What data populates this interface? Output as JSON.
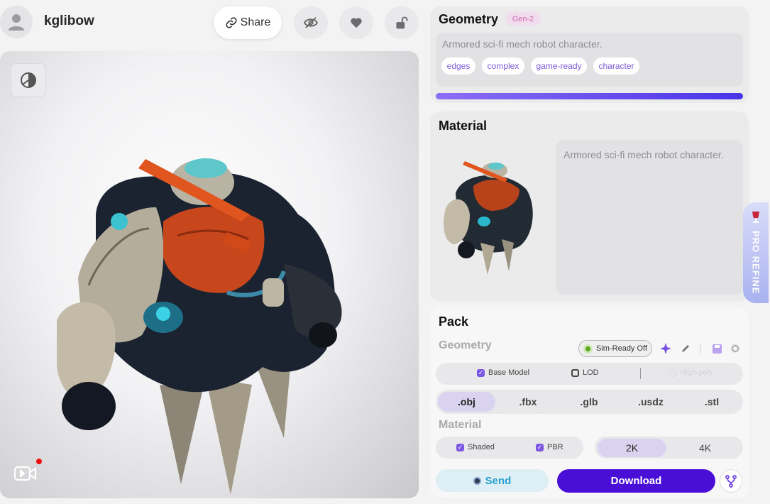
{
  "header": {
    "username": "kglibow",
    "share_label": "Share"
  },
  "geometry": {
    "title": "Geometry",
    "badge": "Gen-2",
    "description": "Armored sci-fi mech robot character.",
    "tags": [
      "edges",
      "complex",
      "game-ready",
      "character"
    ]
  },
  "material": {
    "title": "Material",
    "description": "Armored sci-fi mech robot character."
  },
  "pack": {
    "title": "Pack",
    "geometry_label": "Geometry",
    "sim_ready": "Sim-Ready Off",
    "options": {
      "base_model": "Base Model",
      "lod": "LOD",
      "high_poly": "High-poly"
    },
    "formats": [
      ".obj",
      ".fbx",
      ".glb",
      ".usdz",
      ".stl"
    ],
    "active_format": ".obj",
    "material_label": "Material",
    "material_options": {
      "shaded": "Shaded",
      "pbr": "PBR"
    },
    "resolutions": [
      "2K",
      "4K"
    ],
    "active_resolution": "2K",
    "send_label": "Send",
    "download_label": "Download"
  },
  "side_tab": {
    "label": "PRO REFINE"
  },
  "colors": {
    "accent": "#4a0fd6",
    "progress_start": "#8b6ff5",
    "progress_end": "#4a34e8",
    "tag_text": "#7c5bd6",
    "badge_bg": "#f1dcee",
    "send_text": "#2aa0cd"
  },
  "icons": {
    "avatar": "user-icon",
    "share": "link-icon",
    "visibility": "eye-off-icon",
    "like": "heart-icon",
    "lock": "unlock-icon",
    "theme": "contrast-icon",
    "video": "video-icon",
    "fork": "fork-icon"
  }
}
